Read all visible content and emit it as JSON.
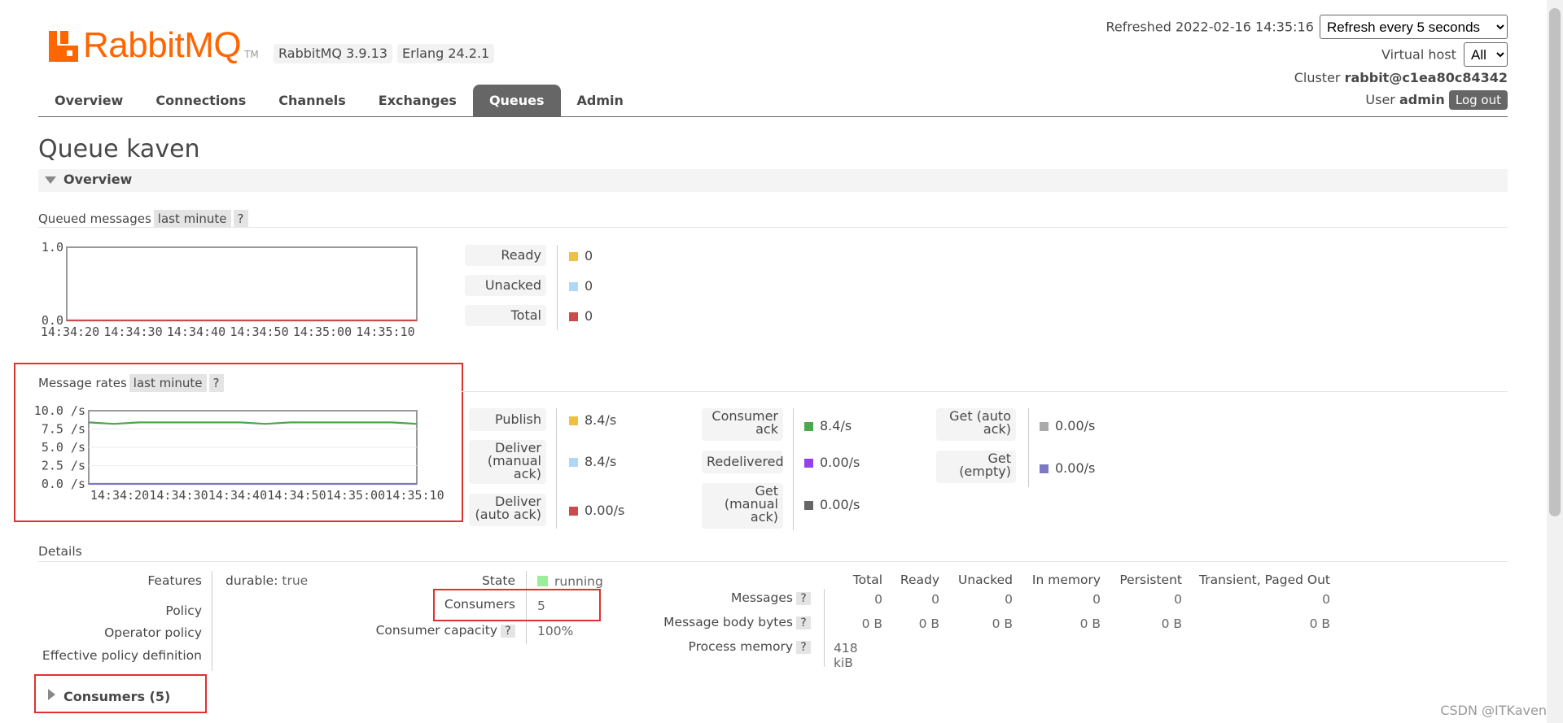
{
  "header": {
    "logo_text": "RabbitMQ",
    "logo_tm": "TM",
    "version": "RabbitMQ 3.9.13",
    "erlang": "Erlang 24.2.1",
    "refreshed_label": "Refreshed 2022-02-16 14:35:16",
    "refresh_select": "Refresh every 5 seconds",
    "virtual_host_label": "Virtual host",
    "virtual_host_value": "All",
    "cluster_label": "Cluster",
    "cluster_value": "rabbit@c1ea80c84342",
    "user_label": "User",
    "user_value": "admin",
    "logout_label": "Log out"
  },
  "nav": [
    {
      "label": "Overview",
      "active": false
    },
    {
      "label": "Connections",
      "active": false
    },
    {
      "label": "Channels",
      "active": false
    },
    {
      "label": "Exchanges",
      "active": false
    },
    {
      "label": "Queues",
      "active": true
    },
    {
      "label": "Admin",
      "active": false
    }
  ],
  "page": {
    "title": "Queue kaven",
    "overview_section": "Overview",
    "queued_messages_label": "Queued messages",
    "message_rates_label": "Message rates",
    "period_pill": "last minute",
    "help": "?"
  },
  "queued_stats": [
    {
      "label": "Ready",
      "value": "0",
      "color": "#edc240"
    },
    {
      "label": "Unacked",
      "value": "0",
      "color": "#afd8f8"
    },
    {
      "label": "Total",
      "value": "0",
      "color": "#cb4b4b"
    }
  ],
  "rate_stats": {
    "col1": [
      {
        "label": "Publish",
        "value": "8.4/s",
        "color": "#edc240"
      },
      {
        "label": "Deliver (manual ack)",
        "value": "8.4/s",
        "color": "#afd8f8"
      },
      {
        "label": "Deliver (auto ack)",
        "value": "0.00/s",
        "color": "#cb4b4b"
      }
    ],
    "col2": [
      {
        "label": "Consumer ack",
        "value": "8.4/s",
        "color": "#4da74d"
      },
      {
        "label": "Redelivered",
        "value": "0.00/s",
        "color": "#9440ed"
      },
      {
        "label": "Get (manual ack)",
        "value": "0.00/s",
        "color": "#666666"
      }
    ],
    "col3": [
      {
        "label": "Get (auto ack)",
        "value": "0.00/s",
        "color": "#aaaaaa"
      },
      {
        "label": "Get (empty)",
        "value": "0.00/s",
        "color": "#7c79c3"
      }
    ]
  },
  "chart_data": [
    {
      "type": "line",
      "x": [
        "14:34:20",
        "14:34:30",
        "14:34:40",
        "14:34:50",
        "14:35:00",
        "14:35:10"
      ],
      "ylim": [
        0,
        1.0
      ],
      "yticks": [
        "1.0",
        "0.0"
      ],
      "series": [
        {
          "name": "Total",
          "color": "#cb4b4b",
          "values": [
            0,
            0,
            0,
            0,
            0,
            0
          ]
        }
      ]
    },
    {
      "type": "line",
      "x": [
        "14:34:20",
        "14:34:30",
        "14:34:40",
        "14:34:50",
        "14:35:00",
        "14:35:10"
      ],
      "ylim": [
        0,
        10
      ],
      "yticks": [
        "10.0 /s",
        "7.5 /s",
        "5.0 /s",
        "2.5 /s",
        "0.0 /s"
      ],
      "series": [
        {
          "name": "Consumer ack",
          "color": "#4da74d",
          "values": [
            8.4,
            8.2,
            8.4,
            8.4,
            8.4,
            8.4,
            8.4,
            8.2,
            8.4,
            8.4,
            8.4,
            8.4,
            8.4,
            8.2
          ]
        },
        {
          "name": "Get (empty)",
          "color": "#7c79c3",
          "values": [
            0,
            0,
            0,
            0,
            0,
            0,
            0,
            0,
            0,
            0,
            0,
            0,
            0,
            0
          ]
        }
      ]
    }
  ],
  "details": {
    "section_label": "Details",
    "features_label": "Features",
    "features_key": "durable:",
    "features_value": "true",
    "policy_label": "Policy",
    "operator_policy_label": "Operator policy",
    "effective_policy_label": "Effective policy definition",
    "state_label": "State",
    "state_value": "running",
    "state_color": "#9bee9b",
    "consumers_label": "Consumers",
    "consumers_value": "5",
    "consumer_capacity_label": "Consumer capacity",
    "consumer_capacity_value": "100%",
    "table_headers": [
      "Total",
      "Ready",
      "Unacked",
      "In memory",
      "Persistent",
      "Transient, Paged Out"
    ],
    "rows": [
      {
        "label": "Messages",
        "values": [
          "0",
          "0",
          "0",
          "0",
          "0",
          "0"
        ]
      },
      {
        "label": "Message body bytes",
        "values": [
          "0 B",
          "0 B",
          "0 B",
          "0 B",
          "0 B",
          "0 B"
        ]
      },
      {
        "label": "Process memory",
        "values": [
          "418 kiB"
        ]
      }
    ]
  },
  "consumers_section": "Consumers (5)",
  "watermark": "CSDN @ITKaven"
}
